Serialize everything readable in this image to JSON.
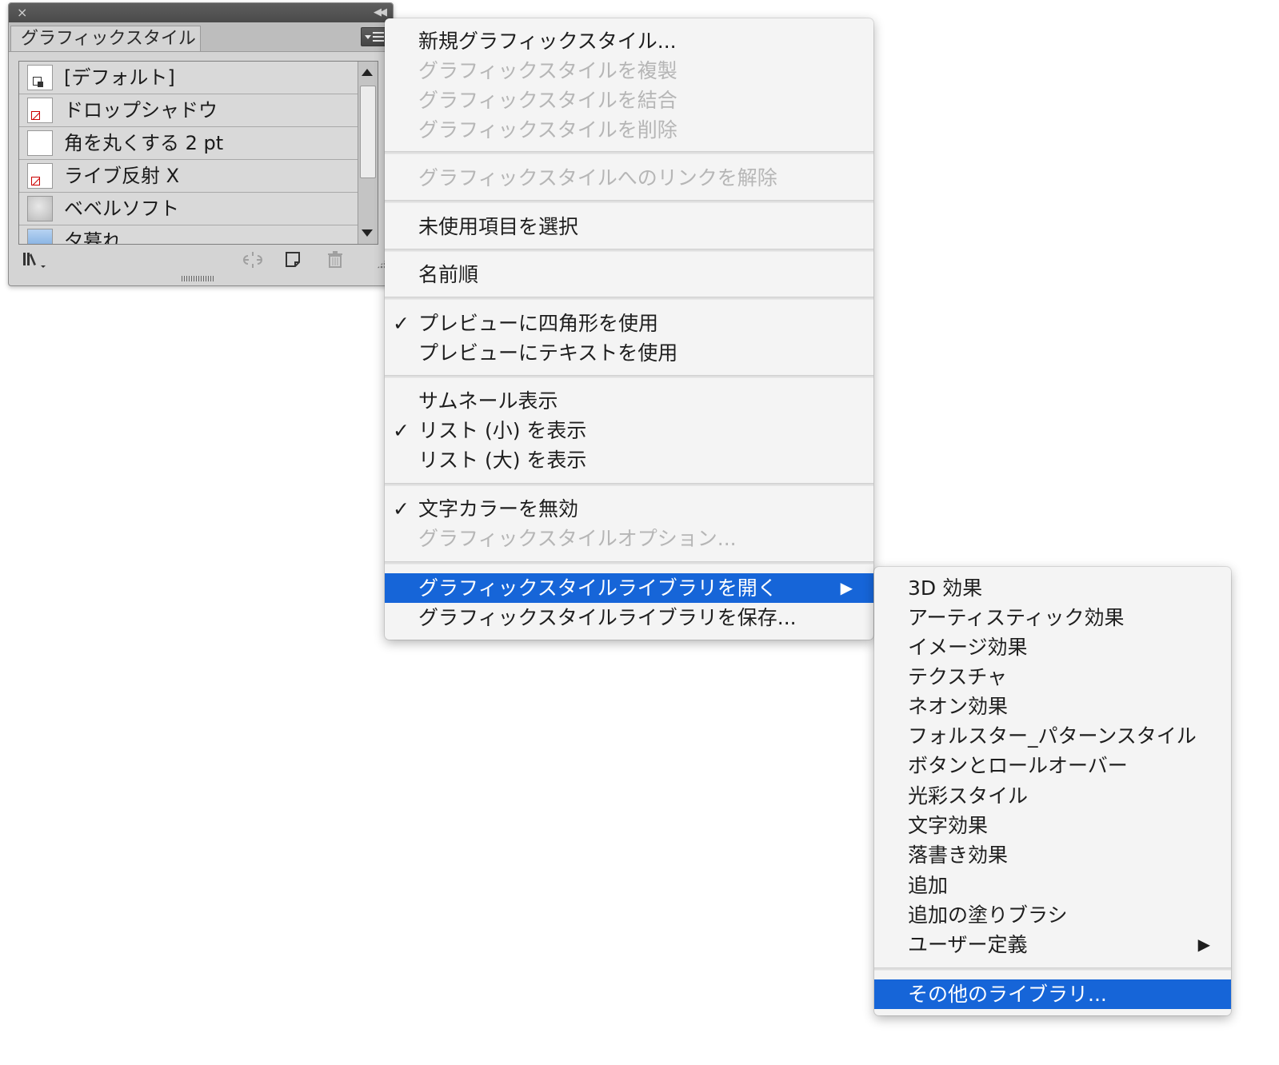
{
  "panel": {
    "tab_label": "グラフィックスタイル",
    "close_glyph": "×",
    "collapse_glyph": "◀◀",
    "items": [
      {
        "label": "[デフォルト]",
        "thumb": "default"
      },
      {
        "label": "ドロップシャドウ",
        "thumb": "none"
      },
      {
        "label": "角を丸くする 2 pt",
        "thumb": "blank"
      },
      {
        "label": "ライブ反射 X",
        "thumb": "none"
      },
      {
        "label": "ベベルソフト",
        "thumb": "bevel"
      },
      {
        "label": "夕暮れ",
        "thumb": "blue"
      }
    ],
    "footer_icons": [
      "graphic-style-libraries-menu-icon",
      "break-link-icon",
      "new-graphic-style-icon",
      "trash-icon"
    ]
  },
  "main_menu": {
    "items": [
      {
        "label": "新規グラフィックスタイル...",
        "enabled": true
      },
      {
        "label": "グラフィックスタイルを複製",
        "enabled": false
      },
      {
        "label": "グラフィックスタイルを結合",
        "enabled": false
      },
      {
        "label": "グラフィックスタイルを削除",
        "enabled": false
      },
      {
        "label": "グラフィックスタイルへのリンクを解除",
        "enabled": false
      },
      {
        "label": "未使用項目を選択",
        "enabled": true
      },
      {
        "label": "名前順",
        "enabled": true
      },
      {
        "label": "プレビューに四角形を使用",
        "enabled": true,
        "checked": true
      },
      {
        "label": "プレビューにテキストを使用",
        "enabled": true
      },
      {
        "label": "サムネール表示",
        "enabled": true
      },
      {
        "label": "リスト (小) を表示",
        "enabled": true,
        "checked": true
      },
      {
        "label": "リスト (大) を表示",
        "enabled": true
      },
      {
        "label": "文字カラーを無効",
        "enabled": true,
        "checked": true
      },
      {
        "label": "グラフィックスタイルオプション...",
        "enabled": false
      },
      {
        "label": "グラフィックスタイルライブラリを開く",
        "enabled": true,
        "highlighted": true,
        "submenu": true
      },
      {
        "label": "グラフィックスタイルライブラリを保存...",
        "enabled": true
      }
    ],
    "check_glyph": "✓",
    "submenu_arrow": "▶"
  },
  "sub_menu": {
    "items": [
      {
        "label": "3D 効果"
      },
      {
        "label": "アーティスティック効果"
      },
      {
        "label": "イメージ効果"
      },
      {
        "label": "テクスチャ"
      },
      {
        "label": "ネオン効果"
      },
      {
        "label": "フォルスター_パターンスタイル"
      },
      {
        "label": "ボタンとロールオーバー"
      },
      {
        "label": "光彩スタイル"
      },
      {
        "label": "文字効果"
      },
      {
        "label": "落書き効果"
      },
      {
        "label": "追加"
      },
      {
        "label": "追加の塗りブラシ"
      },
      {
        "label": "ユーザー定義",
        "submenu": true
      },
      {
        "label": "その他のライブラリ...",
        "highlighted": true
      }
    ]
  },
  "colors": {
    "highlight": "#1665d8",
    "disabled_text": "#b6b6b6",
    "menu_bg": "#f4f4f4",
    "panel_bg": "#d4d4d4"
  }
}
